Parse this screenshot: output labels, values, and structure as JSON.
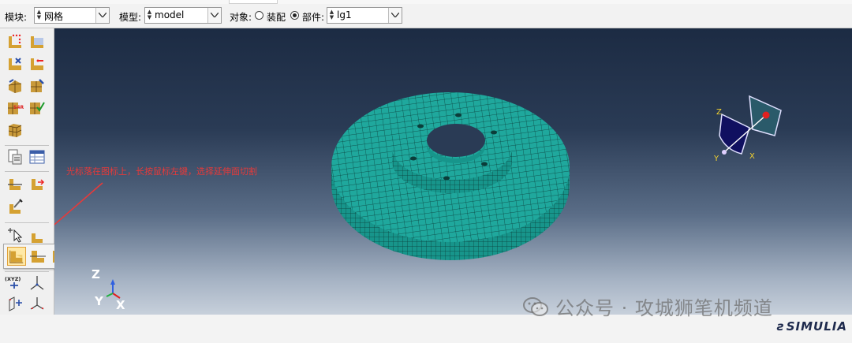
{
  "toolbar": {
    "module_label": "模块:",
    "module_value": "网格",
    "model_label": "模型:",
    "model_value": "model",
    "object_label": "对象:",
    "assembly_option": "装配",
    "part_option": "部件:",
    "part_value": "lg1"
  },
  "annotation": "光标落在图标上，长按鼠标左键，选择延伸面切割",
  "triad": {
    "z": "Z",
    "y": "Y",
    "x": "X"
  },
  "view_cube": {
    "z": "Z",
    "y": "Y",
    "x": "X"
  },
  "sidebar": {
    "xyz_label": "(XYZ)"
  },
  "watermark": "公众号 · 攻城狮笔机频道",
  "brand": "SIMULIA",
  "colors": {
    "mesh": "#1fa89d",
    "mesh_lines": "#0b3d3a",
    "annotation": "#e63a3a",
    "background_top": "#1c2b43"
  }
}
